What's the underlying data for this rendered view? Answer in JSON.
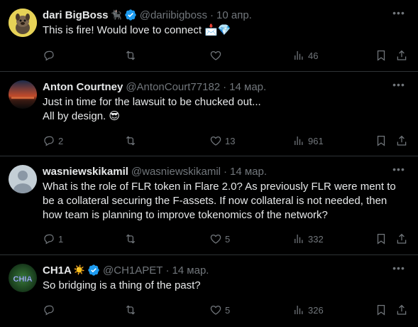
{
  "colors": {
    "background": "#000000",
    "text": "#e7e9ea",
    "muted": "#71767b",
    "verified": "#1d9bf0",
    "divider": "#2f3336"
  },
  "tweets": [
    {
      "name": "dari BigBoss",
      "name_emoji": "🐈‍⬛",
      "verified": true,
      "handle": "@dariibigboss",
      "dot": "·",
      "time": "10 апр.",
      "text": "This is fire! Would love to connect 📩💎",
      "replies": "",
      "retweets": "",
      "likes": "",
      "views": "46",
      "avatar_icon": "dog-avatar"
    },
    {
      "name": "Anton Courtney",
      "verified": false,
      "handle": "@AntonCourt77182",
      "dot": "·",
      "time": "14 мар.",
      "text": "Just in time for the lawsuit to be chucked out...\nAll by design. 😎",
      "replies": "2",
      "retweets": "",
      "likes": "13",
      "views": "961",
      "avatar_icon": "sunset-avatar"
    },
    {
      "name": "wasniewskikamil",
      "verified": false,
      "handle": "@wasniewskikamil",
      "dot": "·",
      "time": "14 мар.",
      "text": "What is the role of FLR token in Flare 2.0? As previously FLR were ment to be a collateral securing the F-assets. If now collateral is not needed, then how team is planning to improve tokenomics of the network?",
      "replies": "1",
      "retweets": "",
      "likes": "5",
      "views": "332",
      "avatar_icon": "default-avatar"
    },
    {
      "name": "CH1A",
      "name_emoji": "☀️",
      "verified": true,
      "handle": "@CH1APET",
      "dot": "·",
      "time": "14 мар.",
      "text": "So bridging is a thing of the past?",
      "replies": "",
      "retweets": "",
      "likes": "5",
      "views": "326",
      "avatar_icon": "ch1a-logo-avatar",
      "avatar_text": "CHIA"
    }
  ]
}
